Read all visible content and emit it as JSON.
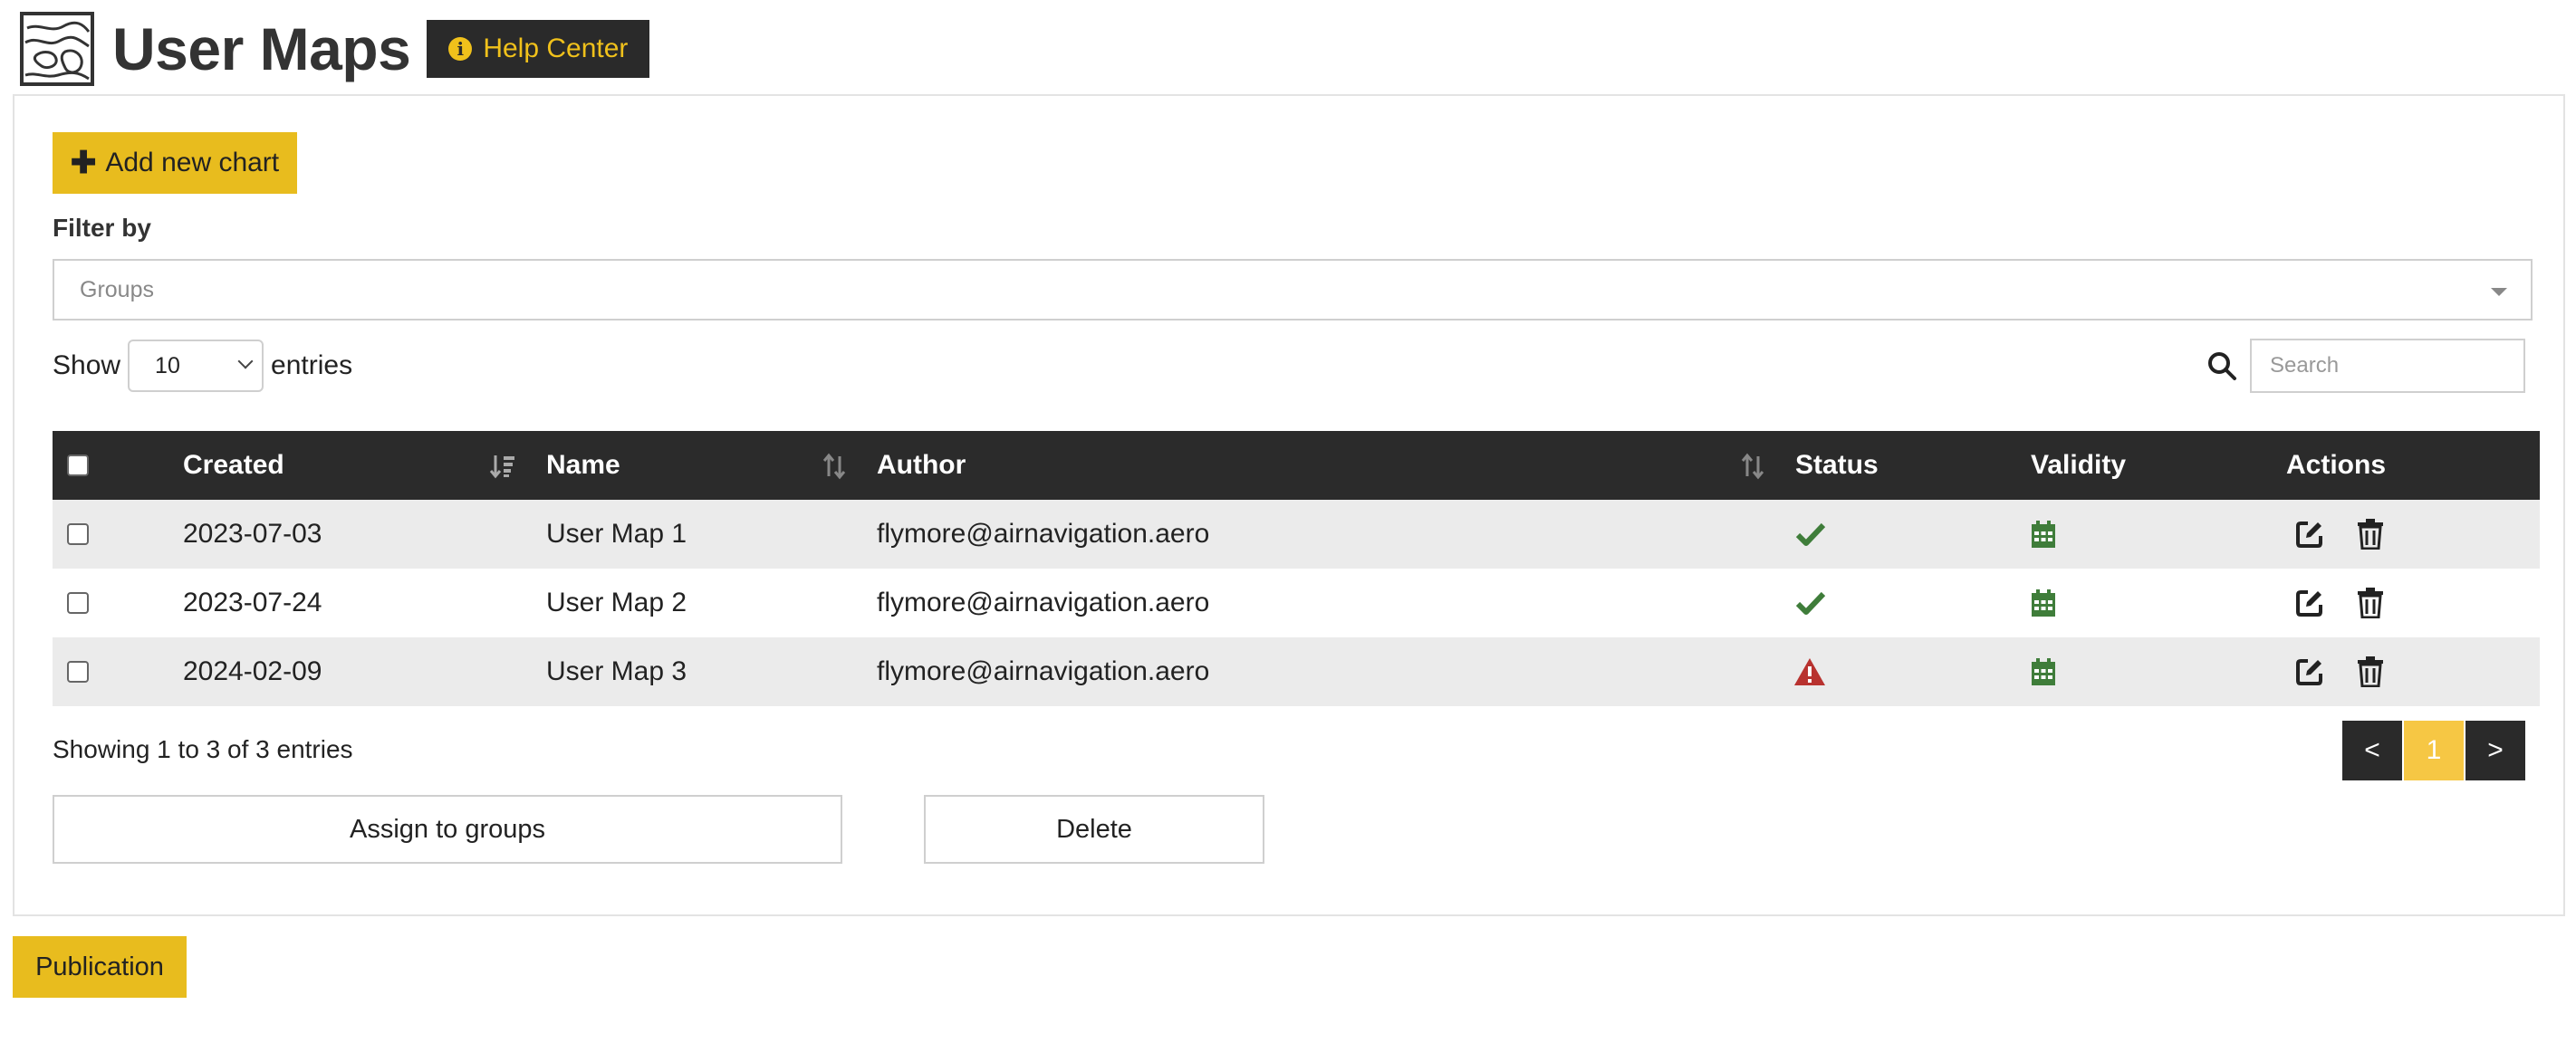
{
  "header": {
    "title": "User Maps",
    "help_label": "Help Center"
  },
  "toolbar": {
    "add_label": "Add new chart"
  },
  "filter": {
    "label": "Filter by",
    "groups_placeholder": "Groups"
  },
  "length": {
    "show_label": "Show",
    "value": "10",
    "entries_label": "entries"
  },
  "search": {
    "placeholder": "Search"
  },
  "table": {
    "columns": [
      "Created",
      "Name",
      "Author",
      "Status",
      "Validity",
      "Actions"
    ],
    "rows": [
      {
        "created": "2023-07-03",
        "name": "User Map 1",
        "author": "flymore@airnavigation.aero",
        "status": "ok"
      },
      {
        "created": "2023-07-24",
        "name": "User Map 2",
        "author": "flymore@airnavigation.aero",
        "status": "ok"
      },
      {
        "created": "2024-02-09",
        "name": "User Map 3",
        "author": "flymore@airnavigation.aero",
        "status": "warning"
      }
    ]
  },
  "footer": {
    "info": "Showing 1 to 3 of 3 entries",
    "prev": "<",
    "page": "1",
    "next": ">"
  },
  "bulk": {
    "assign_label": "Assign to groups",
    "delete_label": "Delete"
  },
  "publication_label": "Publication",
  "colors": {
    "accent": "#e8bc1e",
    "dark": "#2b2b2b",
    "ok_green": "#3f7d3a",
    "warning_red": "#b8322f",
    "calendar_green": "#3f7d3a"
  },
  "icons": {
    "logo": "map-contour-icon",
    "help": "info-circle-icon",
    "add": "plus-icon",
    "search": "search-icon",
    "sort": "sort-icon",
    "status_ok": "check-icon",
    "status_warning": "warning-triangle-icon",
    "validity": "calendar-icon",
    "edit": "edit-icon",
    "delete": "trash-icon"
  }
}
